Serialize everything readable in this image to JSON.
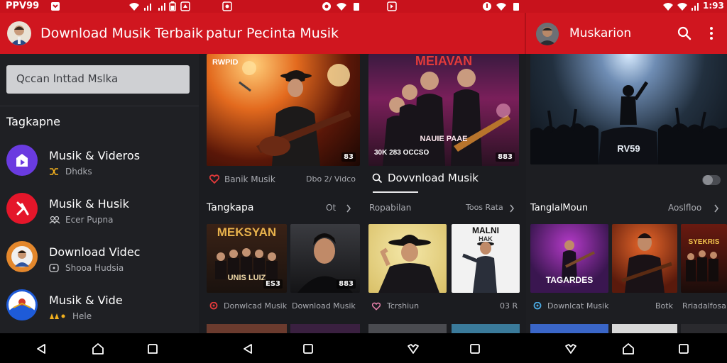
{
  "status": {
    "carrier": "PPV99",
    "time": "1:93"
  },
  "screen1": {
    "title": "Download Musik Terbaik",
    "search_placeholder": "Qccan lnttad Mslka",
    "section": "Tagkapne",
    "items": [
      {
        "title": "Musik & Videros",
        "subtitle": "Dhdks"
      },
      {
        "title": "Musik & Husik",
        "subtitle": "Ecer Pupna"
      },
      {
        "title": "Download Videc",
        "subtitle": "Shooa Hudsia"
      },
      {
        "title": "Musik & Vide",
        "subtitle": "Hele"
      }
    ]
  },
  "screen2": {
    "title": "patur Pecinta Musik",
    "hero_left": {
      "overlay": "RWPID",
      "tag": "83",
      "caption": "Banik Musik",
      "meta": "Dbo 2/ Vidco"
    },
    "hero_right": {
      "overlay_top": "MEIAVAN",
      "overlay_mid": "NAUIE PAAE",
      "overlay_bottom": "30K 283 OCCSO",
      "tag": "883"
    },
    "search_label": "Dovvnload Musik",
    "row_left": {
      "title": "Tangkapa",
      "more": "Ot"
    },
    "row_right": {
      "title": "Ropabilan",
      "more": "Toos Rata"
    },
    "cards": [
      {
        "overlay": "MEKSYAN",
        "sub": "UNIS LUIZ",
        "tag": "ES3",
        "caption": "Donwlcad Musik"
      },
      {
        "tag": "883",
        "caption": "Download Musik"
      },
      {
        "caption": "Tcrshiun"
      },
      {
        "overlay": "MALNI",
        "sub": "HAK",
        "caption": "03 R"
      }
    ]
  },
  "screen3": {
    "title": "Muskarion",
    "hero_overlay": "RV59",
    "row_title": "TanglalMoun",
    "row_more": "Aoslfloo",
    "cards": [
      {
        "overlay": "TAGARDES",
        "caption": "Downlcat Musik"
      },
      {
        "caption": "Botk"
      },
      {
        "overlay": "SYEKRIS",
        "caption": "Rriadalfosa"
      }
    ]
  },
  "colors": {
    "red": "#d0161f",
    "bg": "#1d1e22"
  }
}
